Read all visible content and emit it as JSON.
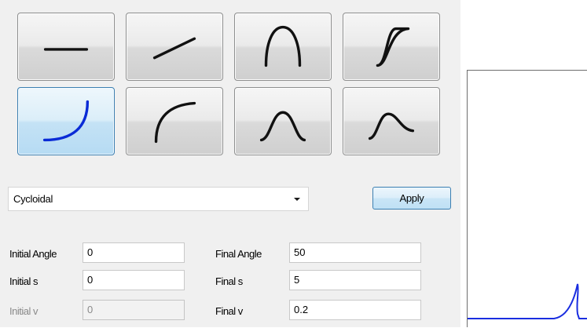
{
  "profile_buttons": [
    {
      "icon": "horizontal-line-icon",
      "selected": false
    },
    {
      "icon": "diagonal-line-icon",
      "selected": false
    },
    {
      "icon": "parabola-arch-icon",
      "selected": false
    },
    {
      "icon": "s-curve-icon",
      "selected": false
    },
    {
      "icon": "concave-rise-curve-icon",
      "selected": true
    },
    {
      "icon": "convex-rise-curve-icon",
      "selected": false
    },
    {
      "icon": "bell-curve-icon",
      "selected": false
    },
    {
      "icon": "asymmetric-bell-curve-icon",
      "selected": false
    }
  ],
  "motion_type": {
    "selected": "Cycloidal"
  },
  "apply_label": "Apply",
  "params": {
    "initial_angle": {
      "label": "Initial Angle",
      "value": "0"
    },
    "initial_s": {
      "label": "Initial s",
      "value": "0"
    },
    "initial_v": {
      "label": "Initial v",
      "value": "0",
      "disabled": true
    },
    "final_angle": {
      "label": "Final Angle",
      "value": "50"
    },
    "final_s": {
      "label": "Final s",
      "value": "5"
    },
    "final_v": {
      "label": "Final v",
      "value": "0.2"
    }
  },
  "colors": {
    "curve_selected": "#0a2bd6",
    "curve_default": "#111111",
    "plot_line": "#1a2ee0"
  }
}
